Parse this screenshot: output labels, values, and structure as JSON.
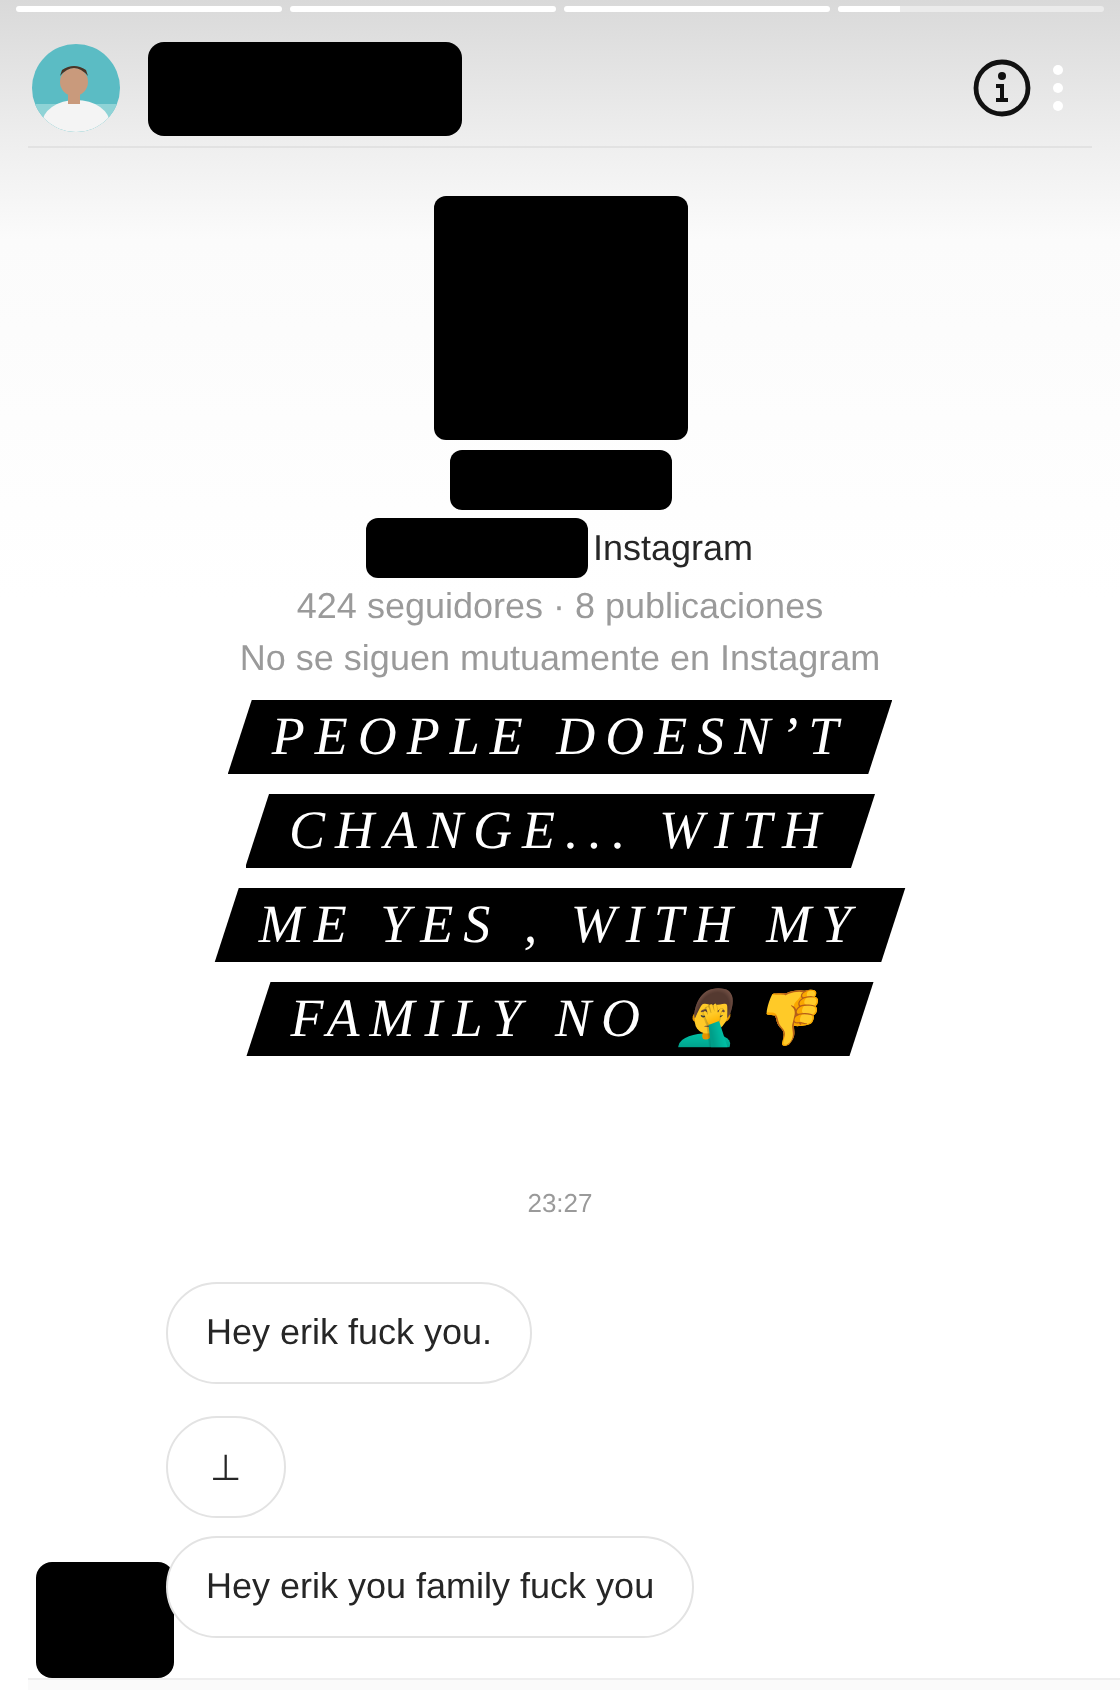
{
  "story_progress": [
    {
      "level": 1
    },
    {
      "level": 1
    },
    {
      "level": 1
    },
    {
      "level": 0.23
    }
  ],
  "profile": {
    "platform": "Instagram",
    "stats": "424 seguidores · 8 publicaciones",
    "mutual": "No se siguen mutuamente en Instagram"
  },
  "caption": [
    "PEOPLE DOESN’T",
    "CHANGE... WITH",
    "ME YES , WITH MY",
    "FAMILY NO 🤦‍♂️👎"
  ],
  "timestamp": "23:27",
  "messages": [
    {
      "text": "Hey erik fuck you.",
      "show_avatar": false
    },
    {
      "text": "⊥",
      "show_avatar": false
    },
    {
      "text": "Hey erik you family fuck you",
      "show_avatar": true
    }
  ]
}
